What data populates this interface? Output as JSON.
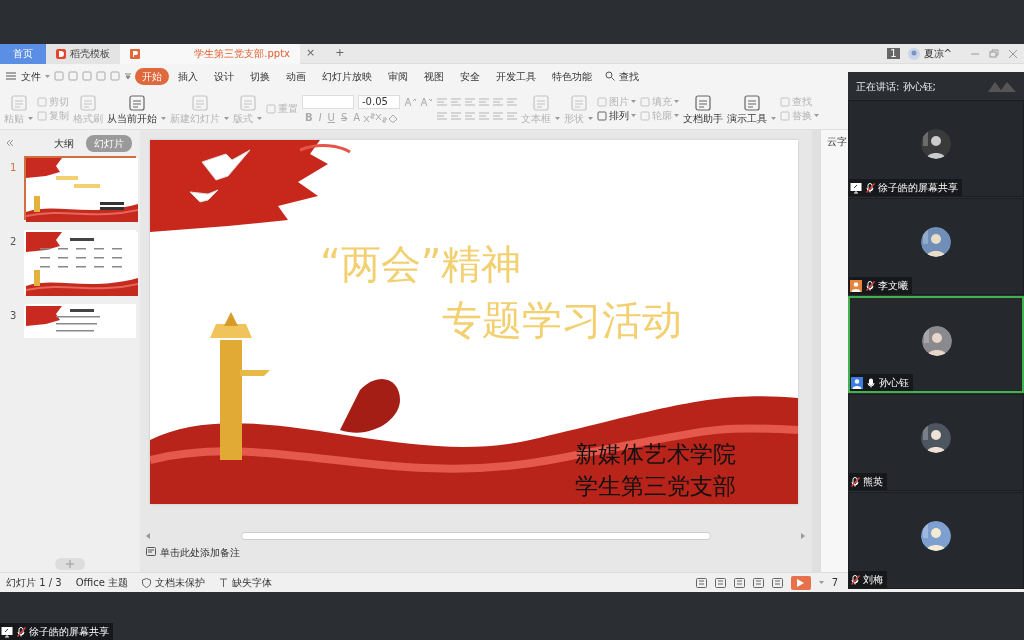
{
  "window_tabs": [
    {
      "label": "首页",
      "kind": "home",
      "selected": false
    },
    {
      "label": "稻壳模板",
      "kind": "template",
      "selected": false
    },
    {
      "label": "学生第三党支部.pptx",
      "kind": "document",
      "selected": true
    }
  ],
  "tab_close": "×",
  "tab_add": "+",
  "account": {
    "badge": "1",
    "name": "夏凉^"
  },
  "menu": {
    "file": "文件",
    "tabs": [
      {
        "label": "开始",
        "selected": true
      },
      {
        "label": "插入",
        "selected": false
      },
      {
        "label": "设计",
        "selected": false
      },
      {
        "label": "切换",
        "selected": false
      },
      {
        "label": "动画",
        "selected": false
      },
      {
        "label": "幻灯片放映",
        "selected": false
      },
      {
        "label": "审阅",
        "selected": false
      },
      {
        "label": "视图",
        "selected": false
      },
      {
        "label": "安全",
        "selected": false
      },
      {
        "label": "开发工具",
        "selected": false
      },
      {
        "label": "特色功能",
        "selected": false
      }
    ],
    "search": "查找"
  },
  "ribbon": [
    {
      "kind": "large",
      "label": "粘贴",
      "dropdown": true,
      "disabled": true
    },
    {
      "kind": "pair",
      "items": [
        {
          "label": "剪切",
          "dropdown": false,
          "disabled": true
        },
        {
          "label": "复制",
          "dropdown": false,
          "disabled": true
        }
      ]
    },
    {
      "kind": "large",
      "label": "格式刷",
      "dropdown": false,
      "disabled": true
    },
    {
      "kind": "large",
      "label": "从当前开始",
      "dropdown": true,
      "disabled": false
    },
    {
      "kind": "large",
      "label": "新建幻灯片",
      "dropdown": true,
      "disabled": true
    },
    {
      "kind": "large",
      "label": "版式",
      "dropdown": true,
      "disabled": true
    },
    {
      "kind": "pair",
      "items": [
        {
          "label": "重置",
          "dropdown": false,
          "disabled": true
        }
      ]
    },
    {
      "kind": "font",
      "size": "-0.05",
      "styles": [
        "B",
        "I",
        "U",
        "S",
        "A"
      ]
    },
    {
      "kind": "paragraph"
    },
    {
      "kind": "large",
      "label": "文本框",
      "dropdown": true,
      "disabled": true
    },
    {
      "kind": "large",
      "label": "形状",
      "dropdown": true,
      "disabled": true
    },
    {
      "kind": "pair",
      "items": [
        {
          "label": "图片",
          "dropdown": true,
          "disabled": true
        },
        {
          "label": "排列",
          "dropdown": true,
          "disabled": false
        }
      ]
    },
    {
      "kind": "pair",
      "items": [
        {
          "label": "填充",
          "dropdown": true,
          "disabled": true
        },
        {
          "label": "轮廓",
          "dropdown": true,
          "disabled": true
        }
      ]
    },
    {
      "kind": "large",
      "label": "文档助手",
      "dropdown": false,
      "disabled": false
    },
    {
      "kind": "large",
      "label": "演示工具",
      "dropdown": true,
      "disabled": false
    },
    {
      "kind": "pair",
      "items": [
        {
          "label": "查找",
          "dropdown": false,
          "disabled": true
        },
        {
          "label": "替换",
          "dropdown": true,
          "disabled": true
        }
      ]
    }
  ],
  "panel_tabs": [
    {
      "label": "大纲",
      "selected": false
    },
    {
      "label": "幻灯片",
      "selected": true
    }
  ],
  "slides": [
    {
      "number": "1",
      "kind": "title",
      "selected": true
    },
    {
      "number": "2",
      "kind": "table",
      "selected": false
    },
    {
      "number": "3",
      "kind": "list",
      "selected": false
    }
  ],
  "slide": {
    "title_line_1": "“两会”精神",
    "title_line_2": "专题学习活动",
    "org_line_1": "新媒体艺术学院",
    "org_line_2": "学生第三党支部"
  },
  "side_pane": {
    "title": "云字"
  },
  "notes_placeholder": "单击此处添加备注",
  "status_bar": {
    "slide_count": "幻灯片 1 / 3",
    "theme": "Office 主题",
    "protection": "文档未保护",
    "fonts": "缺失字体",
    "zoom": "7"
  },
  "meeting": {
    "speaking": "正在讲话: 孙心钰;",
    "participants": [
      {
        "name": "徐子皓的屏幕共享",
        "kind": "screen",
        "muted": true,
        "selected": false
      },
      {
        "name": "李文曦",
        "kind": "guest",
        "muted": true,
        "selected": false
      },
      {
        "name": "孙心钰",
        "kind": "host",
        "muted": false,
        "selected": true
      },
      {
        "name": "熊英",
        "kind": "none",
        "muted": true,
        "selected": false
      },
      {
        "name": "刘梅",
        "kind": "none",
        "muted": true,
        "selected": false
      }
    ]
  },
  "share_label": {
    "name": "徐子皓的屏幕共享",
    "muted": true
  }
}
